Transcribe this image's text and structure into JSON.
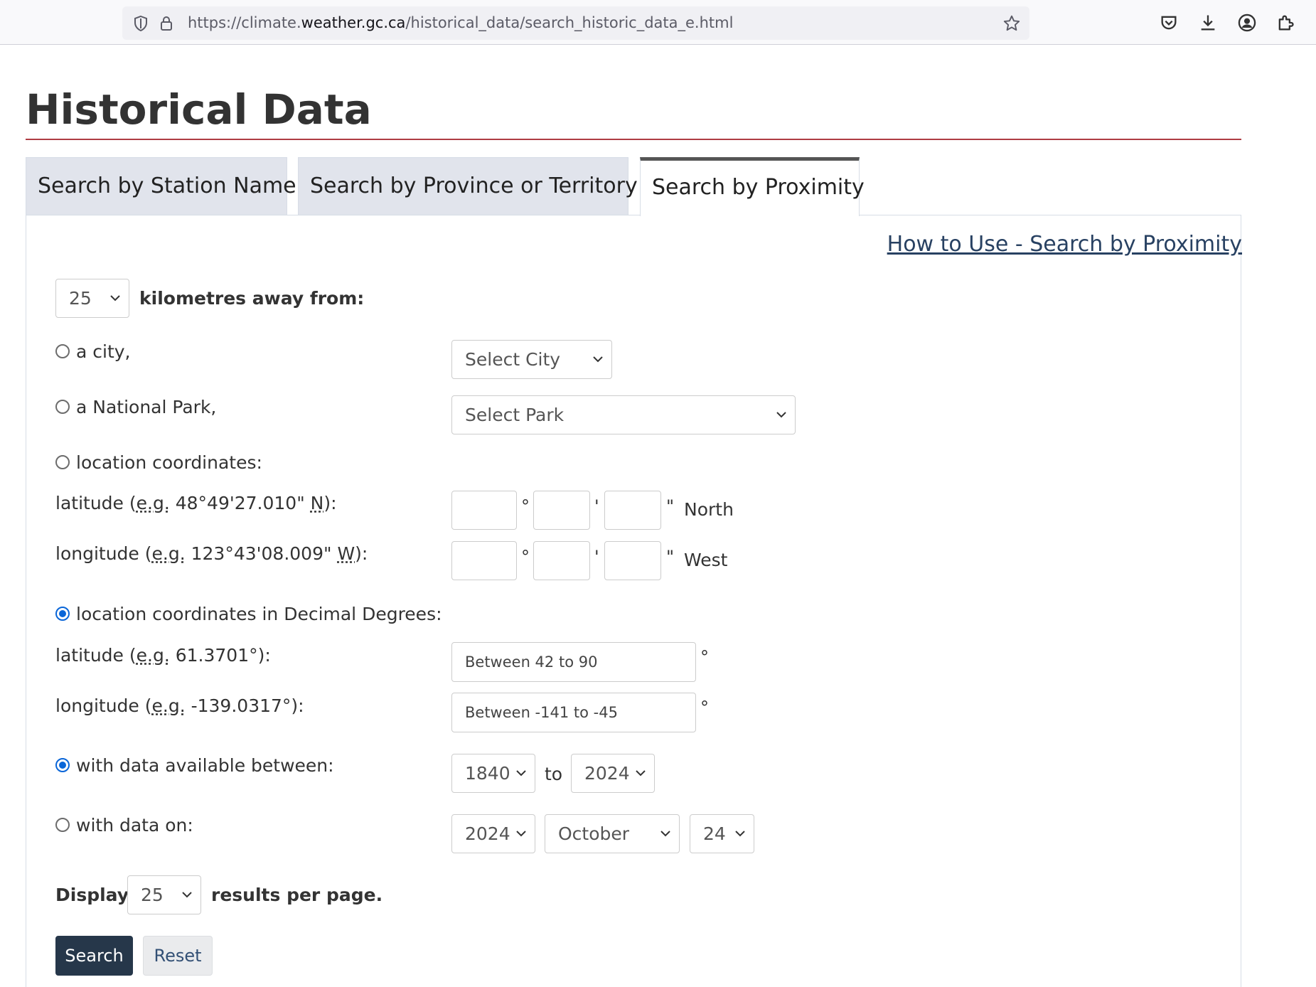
{
  "browser": {
    "url_prefix": "https://climate.",
    "url_domain": "weather.gc.ca",
    "url_path": "/historical_data/search_historic_data_e.html"
  },
  "page": {
    "title": "Historical Data",
    "tabs": [
      {
        "label": "Search by Station Name",
        "active": false
      },
      {
        "label": "Search by Province or Territory",
        "active": false
      },
      {
        "label": "Search by Proximity",
        "active": true
      }
    ],
    "help_link": "How to Use - Search by Proximity"
  },
  "form": {
    "distance": {
      "value": "25",
      "label": "kilometres away from:"
    },
    "city": {
      "label": "a city,",
      "select": "Select City"
    },
    "park": {
      "label": "a National Park,",
      "select": "Select Park"
    },
    "coords": {
      "label": "location coordinates:",
      "lat_prefix": "latitude (",
      "lat_abbr": "e.g.",
      "lat_example": " 48°49'27.010\" ",
      "lat_dir_abbr": "N",
      "lat_suffix": "):",
      "lon_prefix": "longitude (",
      "lon_abbr": "e.g.",
      "lon_example": " 123°43'08.009\" ",
      "lon_dir_abbr": "W",
      "lon_suffix": "):",
      "degree": "°",
      "minute": "'",
      "second": "\"",
      "north": "North",
      "west": "West"
    },
    "decimal": {
      "label": "location coordinates in Decimal Degrees:",
      "lat_prefix": "latitude (",
      "lat_abbr": "e.g.",
      "lat_example": " 61.3701°):",
      "lon_prefix": "longitude (",
      "lon_abbr": "e.g.",
      "lon_example": " -139.0317°):",
      "lat_placeholder": "Between 42 to 90",
      "lon_placeholder": "Between -141 to -45",
      "degree": "°"
    },
    "range": {
      "label": "with data available between:",
      "from": "1840",
      "to_word": "to",
      "to": "2024"
    },
    "on_date": {
      "label": "with data on:",
      "year": "2024",
      "month": "October",
      "day": "24"
    },
    "display": {
      "prefix": "Display",
      "value": "25",
      "suffix": "results per page."
    },
    "buttons": {
      "search": "Search",
      "reset": "Reset"
    }
  }
}
